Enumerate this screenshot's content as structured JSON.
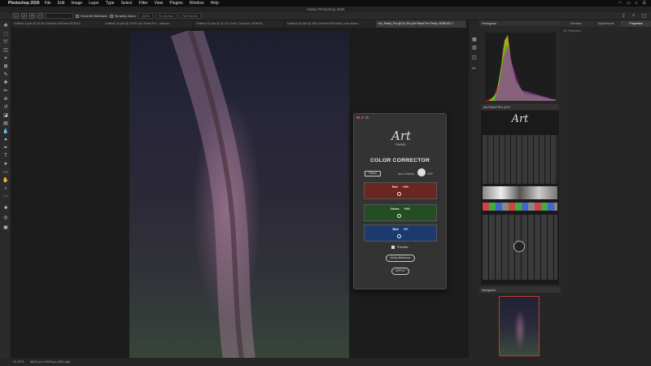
{
  "menubar": {
    "app_name": "Photoshop 2026",
    "items": [
      "File",
      "Edit",
      "Image",
      "Layer",
      "Type",
      "Select",
      "Filter",
      "View",
      "Plugins",
      "Window",
      "Help"
    ]
  },
  "window_title": "Adobe Photoshop 2026",
  "options_bar": {
    "search_placeholder": "",
    "scroll_all": "Scroll All Windows",
    "zoom_level": "100%",
    "fit_screen": "Fit Screen",
    "fill_screen": "Fill Screen",
    "scrubby": "Scrubby Zoom"
  },
  "tabs": [
    {
      "label": "Untitled-3.psb @ 33.3% (Window ArtPanel RGB/16..."
    },
    {
      "label": "Untitled-14.psb @ 18.5% (Art Panel Pro - Instruct..."
    },
    {
      "label": "Untitled-12.psb @ 11.2% (Color Corrector, RGB/16..."
    },
    {
      "label": "Untitled-20.psb @ 25% (ArtPanel/Portfolio Lowe Noise..."
    },
    {
      "label": "Art_Panel_Pro @ 41.3% (Art Panel Pro Temp, RGB/16*) *"
    }
  ],
  "panels": {
    "histogram": "Histogram",
    "art_panel": "Art Panel Pro v2.0",
    "navigator": "Navigator",
    "navigator_zoom": "41.37%",
    "right_tabs": [
      "Libraries",
      "Adjustments",
      "Properties"
    ],
    "no_properties": "No Properties"
  },
  "dialog": {
    "logo_word": "Art",
    "logo_sub": "PANEL",
    "title": "COLOR CORRECTOR",
    "reset": "Reset",
    "auto_label": "Auto Stretch",
    "off_label": "OFF",
    "sliders": [
      {
        "name": "Red",
        "value": "+0%",
        "color": "#6b2622"
      },
      {
        "name": "Green",
        "value": "+0%",
        "color": "#234d22"
      },
      {
        "name": "Blue",
        "value": "0%",
        "color": "#1c3a6e"
      }
    ],
    "preview": "Preview",
    "unify_button": "Unify Midtones",
    "apply_button": "APPLY",
    "preview_checked": true
  },
  "status": {
    "zoom": "41.37%",
    "doc": "4615 px x 6920 px (300 ppi)"
  },
  "colors": {
    "accent_red": "#c0392b"
  }
}
